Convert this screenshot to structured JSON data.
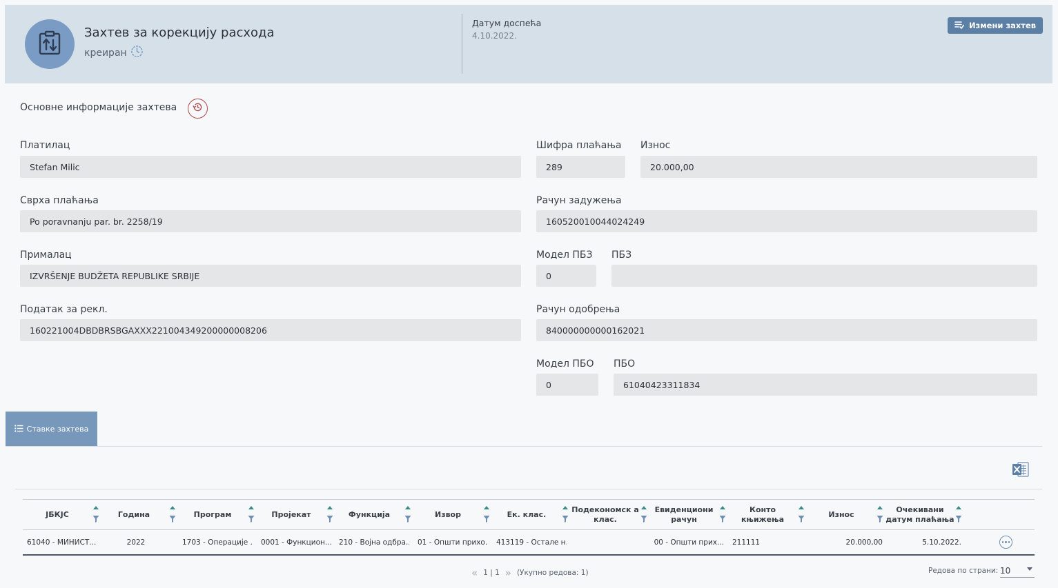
{
  "header": {
    "title": "Захтев за корекцију расхода",
    "status": "креиран",
    "due_label": "Датум доспећа",
    "due_value": "4.10.2022.",
    "edit_button": "Измени захтев"
  },
  "section": {
    "title": "Основне информације захтева"
  },
  "fields": {
    "payer": {
      "label": "Платилац",
      "value": "Stefan Milic"
    },
    "payment_code": {
      "label": "Шифра плаћања",
      "value": "289"
    },
    "amount": {
      "label": "Износ",
      "value": "20.000,00"
    },
    "purpose": {
      "label": "Сврха плаћања",
      "value": "Po poravnanju par. br. 2258/19"
    },
    "debit_account": {
      "label": "Рачун задужења",
      "value": "160520010044024249"
    },
    "recipient": {
      "label": "Прималац",
      "value": "IZVRŠENJE BUDŽETA REPUBLIKE SRBIJE"
    },
    "model_pbz": {
      "label": "Модел ПБЗ",
      "value": "0"
    },
    "pbz": {
      "label": "ПБЗ",
      "value": ""
    },
    "complaint_data": {
      "label": "Податак за рекл.",
      "value": "160221004DBDBRSBGAXXX221004349200000008206"
    },
    "credit_account": {
      "label": "Рачун одобрења",
      "value": "840000000000162021"
    },
    "model_pbo": {
      "label": "Модел ПБО",
      "value": "0"
    },
    "pbo": {
      "label": "ПБО",
      "value": "61040423311834"
    }
  },
  "tab": {
    "label": "Ставке захтева"
  },
  "table": {
    "columns": [
      "ЈБКЈС",
      "Година",
      "Програм",
      "Пројекат",
      "Функција",
      "Извор",
      "Ек. клас.",
      "Подекономск а клас.",
      "Евиденциони рачун",
      "Конто књижења",
      "Износ",
      "Очекивани датум плаћања"
    ],
    "rows": [
      [
        "61040 - МИНИСТ...",
        "2022",
        "1703 - Операције ...",
        "0001 - Функцион...",
        "210 - Војна одбра...",
        "01 - Општи прихо...",
        "413119 - Остале н...",
        "",
        "00 - Општи прих...",
        "211111",
        "20.000,00",
        "5.10.2022."
      ]
    ]
  },
  "pager": {
    "page": "1 | 1",
    "total": "(Укупно редова: 1)",
    "rows_per_page_label": "Редова по страни:",
    "rows_per_page": "10"
  },
  "colors": {
    "header_bg": "#d5e0e8",
    "accent": "#5c7fa6",
    "avatar": "#7a9cc4",
    "tab": "#7898bb",
    "field_bg": "#e4e6e8",
    "sort_arrow": "#3c8c86"
  }
}
